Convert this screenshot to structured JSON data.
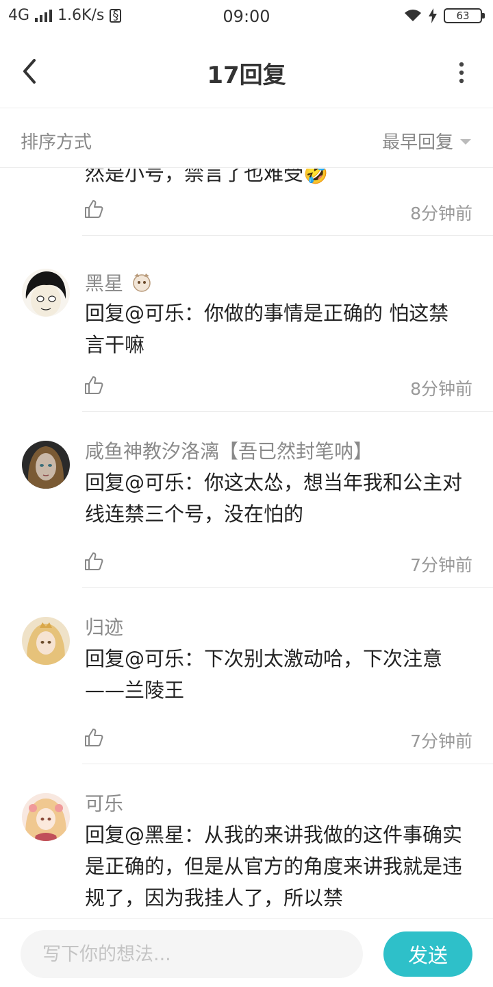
{
  "status_bar": {
    "network": "4G",
    "speed": "1.6K/s",
    "time": "09:00",
    "battery": "63"
  },
  "nav": {
    "title": "17回复"
  },
  "sort": {
    "label": "排序方式",
    "value": "最早回复"
  },
  "comments": [
    {
      "name": "",
      "text": "然是小号，禁言了也难受🤣",
      "time": "8分钟前"
    },
    {
      "name": "黑星",
      "text": "回复@可乐：你做的事情是正确的 怕这禁言干嘛",
      "time": "8分钟前"
    },
    {
      "name": "咸鱼神教汐洛漓【吾已然封笔呐】",
      "text": "回复@可乐：你这太怂，想当年我和公主对线连禁三个号，没在怕的",
      "time": "7分钟前"
    },
    {
      "name": "归迹",
      "text": "回复@可乐：下次别太激动哈，下次注意——兰陵王",
      "time": "7分钟前"
    },
    {
      "name": "可乐",
      "text": "回复@黑星：从我的来讲我做的这件事确实是正确的，但是从官方的角度来讲我就是违规了，因为我挂人了，所以禁",
      "time": ""
    }
  ],
  "composer": {
    "placeholder": "写下你的想法...",
    "send_label": "发送"
  },
  "colors": {
    "accent": "#2ec0c9",
    "muted_text": "#8a8a8a",
    "divider": "#ececec"
  }
}
